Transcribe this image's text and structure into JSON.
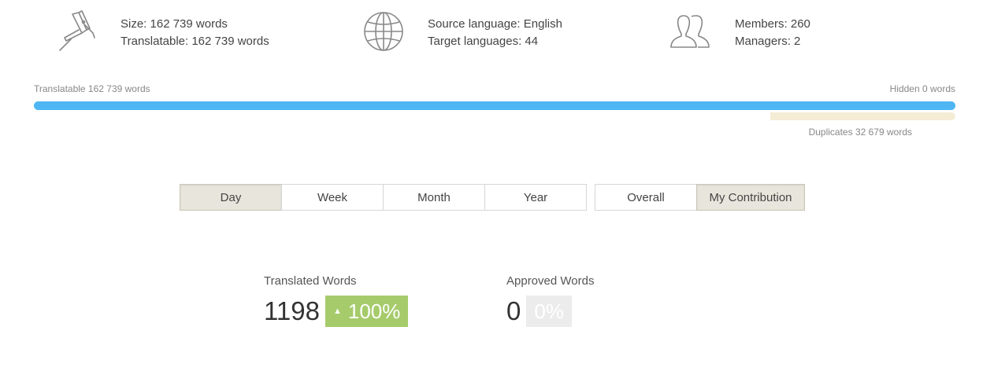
{
  "stats": {
    "size": {
      "icon": "caliper-icon",
      "size_line": "Size: 162 739 words",
      "translatable_line": "Translatable: 162 739 words"
    },
    "languages": {
      "icon": "globe-icon",
      "source_line": "Source language: English",
      "target_line": "Target languages: 44"
    },
    "people": {
      "icon": "users-icon",
      "members_line": "Members: 260",
      "managers_line": "Managers: 2"
    }
  },
  "progress": {
    "translatable_label": "Translatable 162 739 words",
    "hidden_label": "Hidden 0 words",
    "duplicates_label": "Duplicates 32 679 words",
    "translatable_fraction": 1.0,
    "duplicates_fraction": 0.2008,
    "colors": {
      "main": "#4db6f3",
      "duplicates": "#f4ecd4"
    }
  },
  "period_tabs": [
    {
      "label": "Day",
      "active": true
    },
    {
      "label": "Week",
      "active": false
    },
    {
      "label": "Month",
      "active": false
    },
    {
      "label": "Year",
      "active": false
    }
  ],
  "scope_tabs": [
    {
      "label": "Overall",
      "active": false
    },
    {
      "label": "My Contribution",
      "active": true
    }
  ],
  "metrics": {
    "translated": {
      "label": "Translated Words",
      "value": "1198",
      "change": "100%",
      "arrow": "▲",
      "color": "#a6cb6b"
    },
    "approved": {
      "label": "Approved Words",
      "value": "0",
      "change": "0%",
      "color": "#ececec"
    }
  }
}
